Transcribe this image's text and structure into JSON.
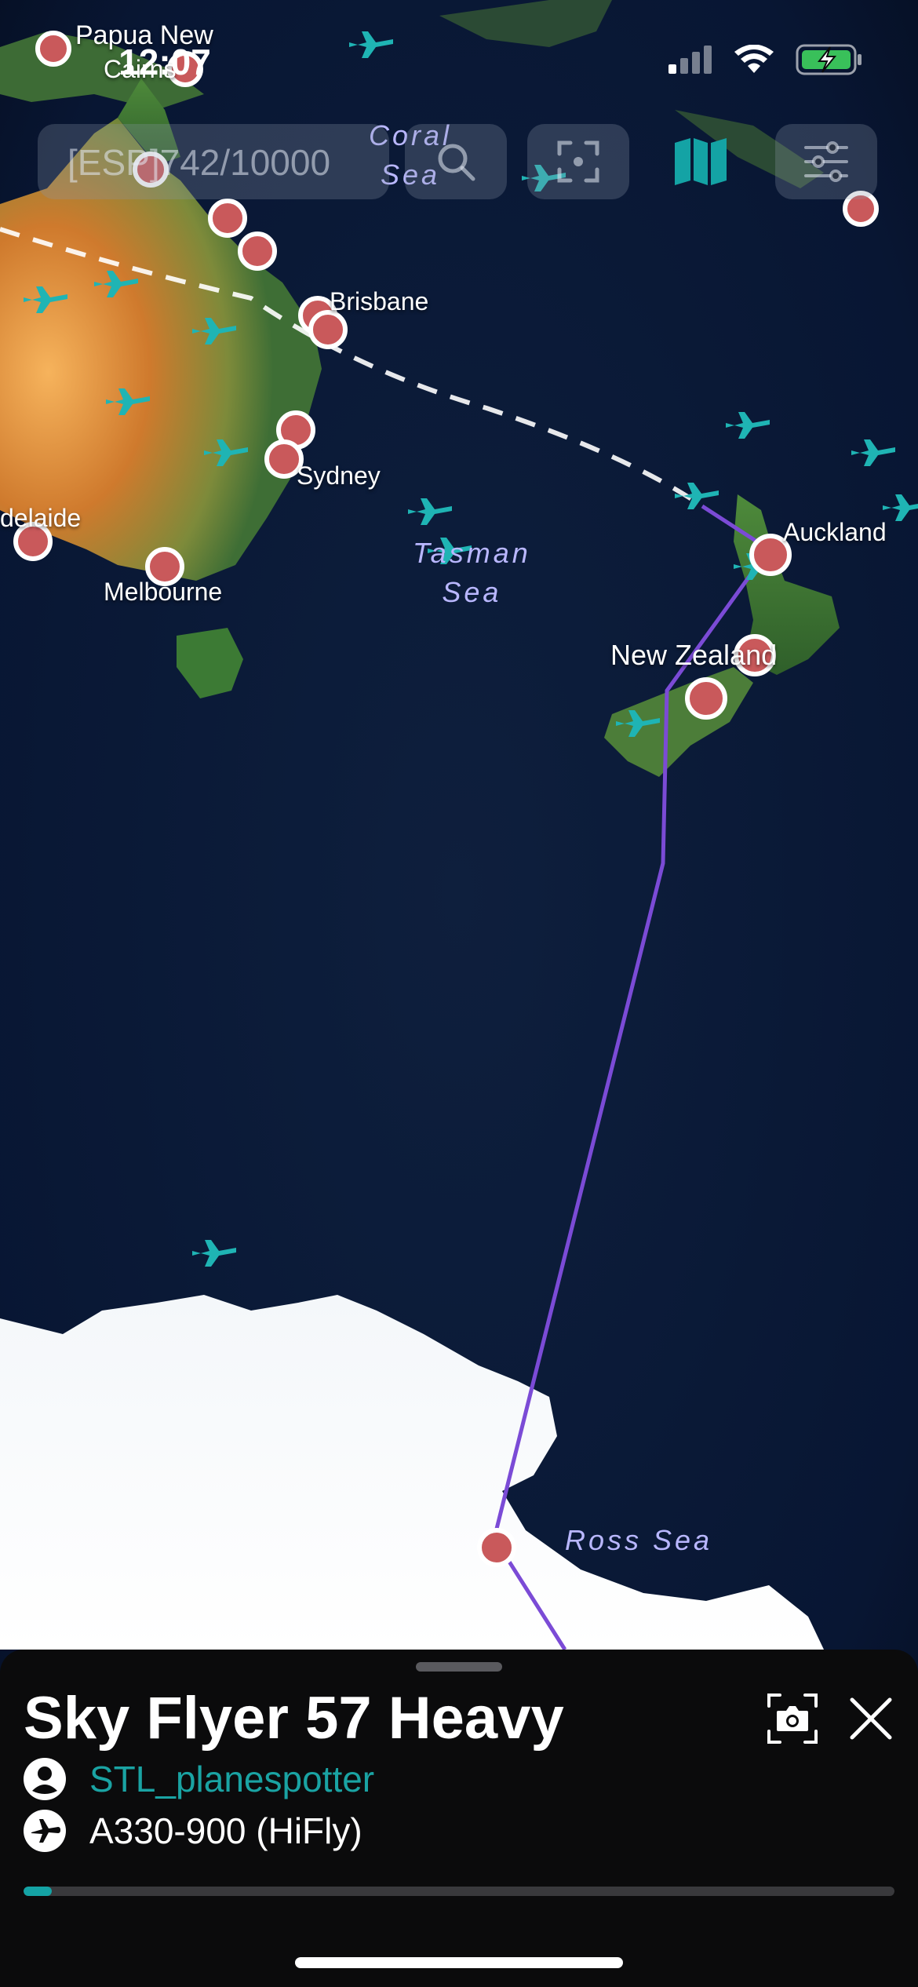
{
  "status_bar": {
    "time": "12:07"
  },
  "search": {
    "value": "[ESP]742/10000"
  },
  "map": {
    "labels": {
      "papua": "Papua New",
      "cairns": "Cairns",
      "brisbane": "Brisbane",
      "sydney": "Sydney",
      "adelaide": "delaide",
      "melbourne": "Melbourne",
      "auckland": "Auckland",
      "new_zealand": "New Zealand"
    },
    "seas": {
      "coral": "Coral\nSea",
      "tasman": "Tasman\nSea",
      "ross": "Ross Sea"
    }
  },
  "flight": {
    "callsign": "Sky Flyer 57 Heavy",
    "spotter": "STL_planespotter",
    "aircraft": "A330-900 (HiFly)",
    "progress_percent": 3.2
  },
  "colors": {
    "accent": "#14a3a5",
    "route": "#7b4bd6",
    "airport": "#c9595b",
    "sheet_bg": "#0b0b0c"
  },
  "icons": {
    "search": "search-icon",
    "focus": "focus-frame-icon",
    "map": "map-icon",
    "filter": "filter-sliders-icon",
    "camera": "camera-icon",
    "close": "close-icon",
    "user": "user-icon",
    "airplane": "airplane-icon"
  }
}
